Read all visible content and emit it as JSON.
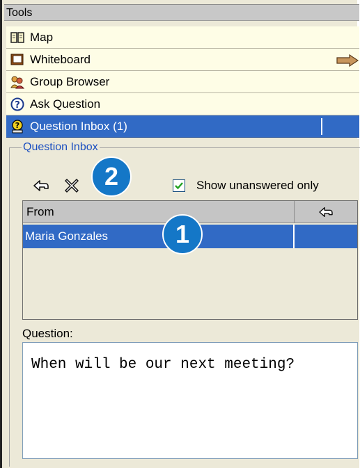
{
  "tools": {
    "header": "Tools",
    "items": [
      {
        "label": "Map",
        "icon": "book-map-icon"
      },
      {
        "label": "Whiteboard",
        "icon": "whiteboard-icon"
      },
      {
        "label": "Group Browser",
        "icon": "group-people-icon"
      },
      {
        "label": "Ask Question",
        "icon": "question-circle-icon"
      },
      {
        "label": "Question Inbox (1)",
        "icon": "question-inbox-icon",
        "selected": true
      }
    ],
    "expand_arrow_icon": "arrow-right-icon"
  },
  "inbox": {
    "group_title": "Question Inbox",
    "toolbar": {
      "reply_icon": "reply-icon",
      "delete_icon": "delete-x-icon"
    },
    "filter": {
      "label": "Show unanswered only",
      "checked": true
    },
    "table": {
      "columns": [
        "From",
        "reply-icon"
      ],
      "rows": [
        {
          "from": "Maria Gonzales",
          "replied": ""
        }
      ]
    },
    "question_label": "Question:",
    "question_text": "When will be our next meeting?"
  },
  "callouts": {
    "one": "1",
    "two": "2"
  },
  "colors": {
    "selection": "#316ac5",
    "item_background": "#fefde6",
    "group_title": "#1b4fc0",
    "callout": "#1477c7",
    "panel": "#ece9d8"
  }
}
